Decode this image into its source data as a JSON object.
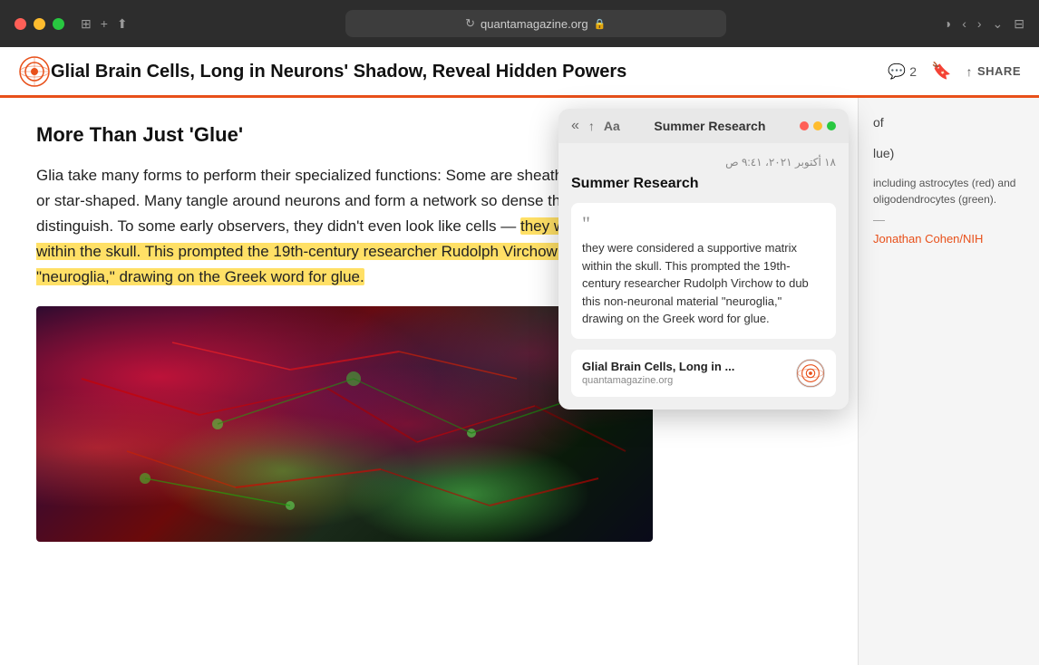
{
  "browser": {
    "url": "quantamagazine.org",
    "reload_icon": "↻",
    "lock_icon": "🔒",
    "privacy_icon": "◑",
    "back_icon": "‹",
    "forward_icon": "›",
    "more_icon": "⌄",
    "tabs_icon": "⊞",
    "traffic_lights": {
      "red": "#ff5f57",
      "yellow": "#febc2e",
      "green": "#28c840"
    }
  },
  "article": {
    "title": "Glial Brain Cells, Long in Neurons' Shadow, Reveal Hidden Powers",
    "comment_count": "2",
    "share_label": "SHARE",
    "section": {
      "heading": "More Than Just 'Glue'"
    },
    "body_text_1": "Glia take many forms to perform their specialized functions: Some are sheathlike, while others are spindly, bushy or star-shaped. Many tangle around neurons and form a network so dense that individual cells are hard to distinguish. To some early observers, they didn't even look like cells —",
    "highlighted_text": "they were considered a supportive matrix within the skull. This prompted the 19th-century researcher Rudolph Virchow to dub this non-neuronal material \"neuroglia,\" drawing on the Greek word for glue.",
    "right_panel": {
      "text_fragment_1": "of",
      "text_fragment_2": "lue)",
      "caption": "including astrocytes (red) and oligodendrocytes (green).",
      "divider": "—",
      "credit": "Jonathan Cohen/NIH"
    }
  },
  "reading_list_popup": {
    "title": "Summer Research",
    "back_icon": "«",
    "share_icon": "↑",
    "font_size_icon": "Aa",
    "date": "١٨ أكتوبر ٢٠٢١، ٩:٤١ ص",
    "note_title": "Summer Research",
    "quote_text": "they were considered a supportive matrix within the skull. This prompted the 19th-century researcher Rudolph Virchow to dub this non-neuronal material \"neuroglia,\" drawing on the Greek word for glue.",
    "source_title": "Glial Brain Cells, Long in ...",
    "source_url": "quantamagazine.org",
    "dots": {
      "red": "#ff5f57",
      "yellow": "#febc2e",
      "green": "#28c840"
    }
  }
}
